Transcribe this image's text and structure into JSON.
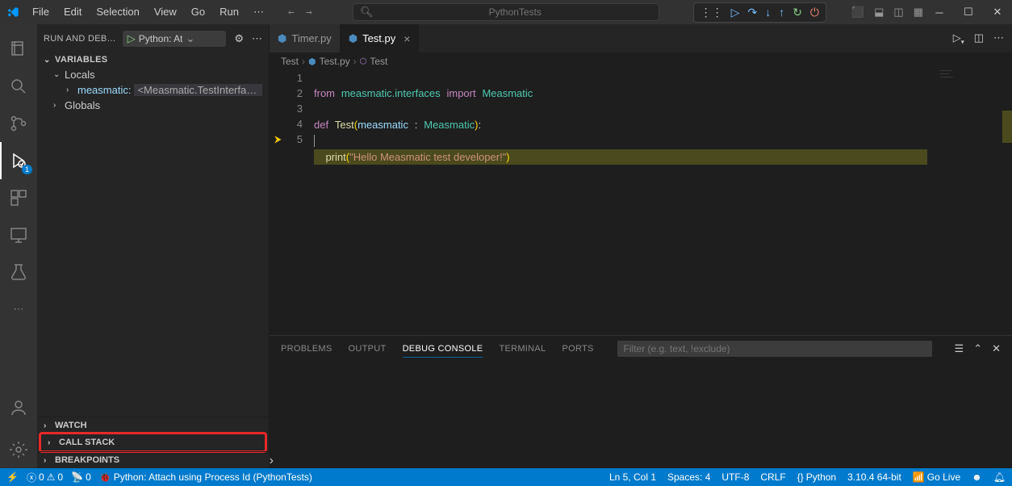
{
  "menu": [
    "File",
    "Edit",
    "Selection",
    "View",
    "Go",
    "Run"
  ],
  "search_placeholder": "PythonTests",
  "sidebar": {
    "title": "RUN AND DEB…",
    "config": "Python: At",
    "sections": {
      "variables": "VARIABLES",
      "locals": "Locals",
      "globals": "Globals",
      "watch": "WATCH",
      "callstack": "CALL STACK",
      "breakpoints": "BREAKPOINTS"
    },
    "var": {
      "name": "measmatic:",
      "value": "<Measmatic.TestInterfa…"
    }
  },
  "tabs": [
    {
      "label": "Timer.py",
      "active": false
    },
    {
      "label": "Test.py",
      "active": true
    }
  ],
  "breadcrumb": {
    "a": "Test",
    "b": "Test.py",
    "c": "Test"
  },
  "code": {
    "line_numbers": [
      "1",
      "2",
      "3",
      "4",
      "5"
    ],
    "l1": {
      "kw1": "from",
      "mod": "measmatic.interfaces",
      "kw2": "import",
      "cls": "Measmatic"
    },
    "l3": {
      "kw": "def",
      "fn": "Test",
      "param": "measmatic",
      "type": "Measmatic"
    },
    "l5": {
      "fn": "print",
      "str": "\"Hello Measmatic test developer!\""
    }
  },
  "panel": {
    "tabs": [
      "PROBLEMS",
      "OUTPUT",
      "DEBUG CONSOLE",
      "TERMINAL",
      "PORTS"
    ],
    "active": "DEBUG CONSOLE",
    "filter_placeholder": "Filter (e.g. text, !exclude)"
  },
  "status": {
    "errors": "0",
    "warnings": "0",
    "ports": "0",
    "debug": "Python: Attach using Process Id (PythonTests)",
    "cursor": "Ln 5, Col 1",
    "spaces": "Spaces: 4",
    "encoding": "UTF-8",
    "eol": "CRLF",
    "lang": "Python",
    "py_version": "3.10.4 64-bit",
    "golive": "Go Live"
  },
  "activity_badge": "1"
}
